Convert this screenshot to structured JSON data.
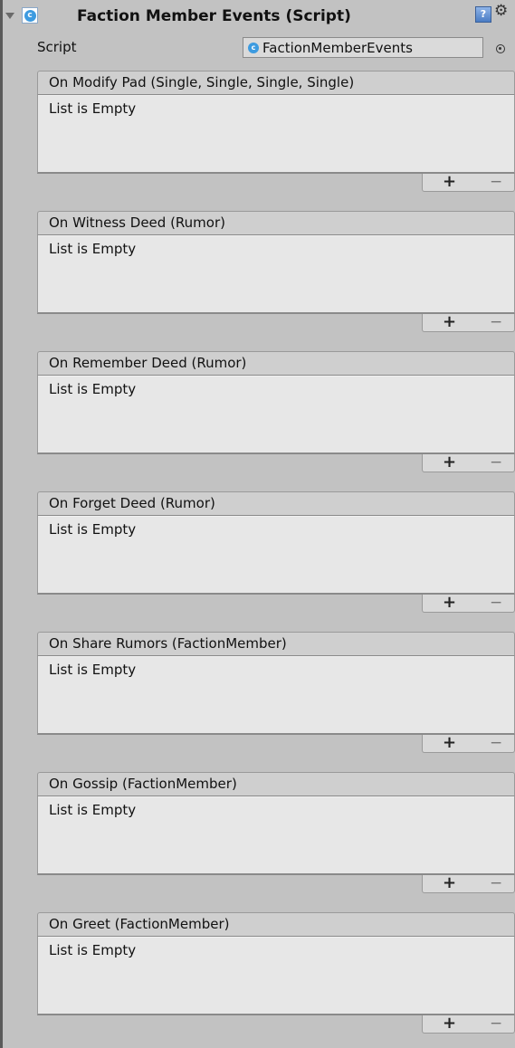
{
  "component": {
    "title": "Faction Member Events (Script)",
    "script_label": "Script",
    "script_value": "FactionMemberEvents",
    "icons": [
      "foldout-arrow-icon",
      "script-icon",
      "help-icon",
      "gear-icon",
      "object-picker-icon"
    ]
  },
  "events": [
    {
      "title": "On Modify Pad (Single, Single, Single, Single)",
      "empty_text": "List is Empty",
      "add_label": "+",
      "remove_label": "−"
    },
    {
      "title": "On Witness Deed (Rumor)",
      "empty_text": "List is Empty",
      "add_label": "+",
      "remove_label": "−"
    },
    {
      "title": "On Remember Deed (Rumor)",
      "empty_text": "List is Empty",
      "add_label": "+",
      "remove_label": "−"
    },
    {
      "title": "On Forget Deed (Rumor)",
      "empty_text": "List is Empty",
      "add_label": "+",
      "remove_label": "−"
    },
    {
      "title": "On Share Rumors (FactionMember)",
      "empty_text": "List is Empty",
      "add_label": "+",
      "remove_label": "−"
    },
    {
      "title": "On Gossip (FactionMember)",
      "empty_text": "List is Empty",
      "add_label": "+",
      "remove_label": "−"
    },
    {
      "title": "On Greet (FactionMember)",
      "empty_text": "List is Empty",
      "add_label": "+",
      "remove_label": "−"
    }
  ]
}
